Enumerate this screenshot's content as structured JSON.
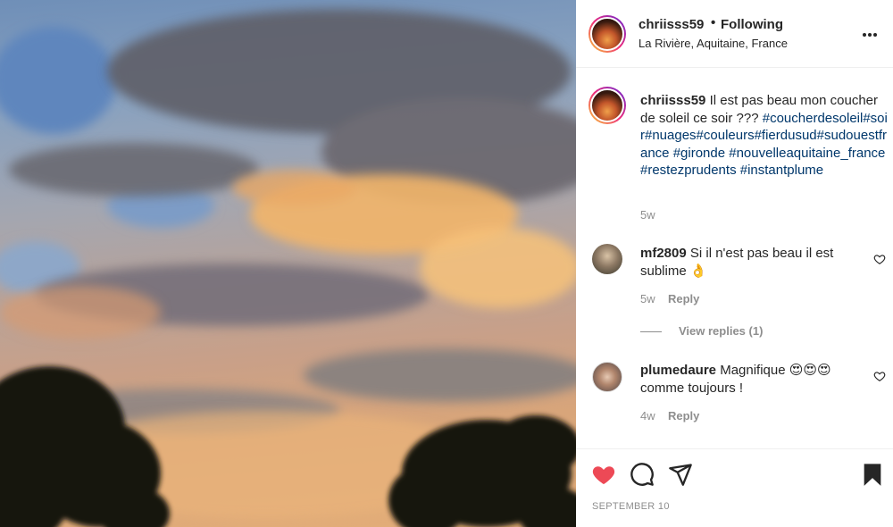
{
  "post": {
    "username": "chriisss59",
    "separator": "•",
    "follow_state": "Following",
    "location": "La Rivière, Aquitaine, France"
  },
  "caption": {
    "username": "chriisss59",
    "text": "Il est pas beau mon coucher de soleil ce soir ???",
    "hashtags": "#coucherdesoleil#soir#nuages#couleurs#fierdusud#sudouestfrance #gironde #nouvelleaquitaine_france #restezprudents #instantplume",
    "time": "5w"
  },
  "comments": [
    {
      "username": "mf2809",
      "text": "Si il n'est pas beau il est sublime 👌",
      "time": "5w",
      "reply_label": "Reply",
      "view_replies": "View replies (1)"
    },
    {
      "username": "plumedaure",
      "text": "Magnifique 😍😍😍 comme toujours !",
      "time": "4w",
      "reply_label": "Reply"
    }
  ],
  "actions": {
    "liked": true,
    "like_color": "#ed4956",
    "saved": true
  },
  "date": "SEPTEMBER 10",
  "icons": {
    "more": "more-options-icon",
    "like": "heart-icon",
    "comment": "comment-bubble-icon",
    "share": "paper-plane-icon",
    "save": "bookmark-icon"
  }
}
